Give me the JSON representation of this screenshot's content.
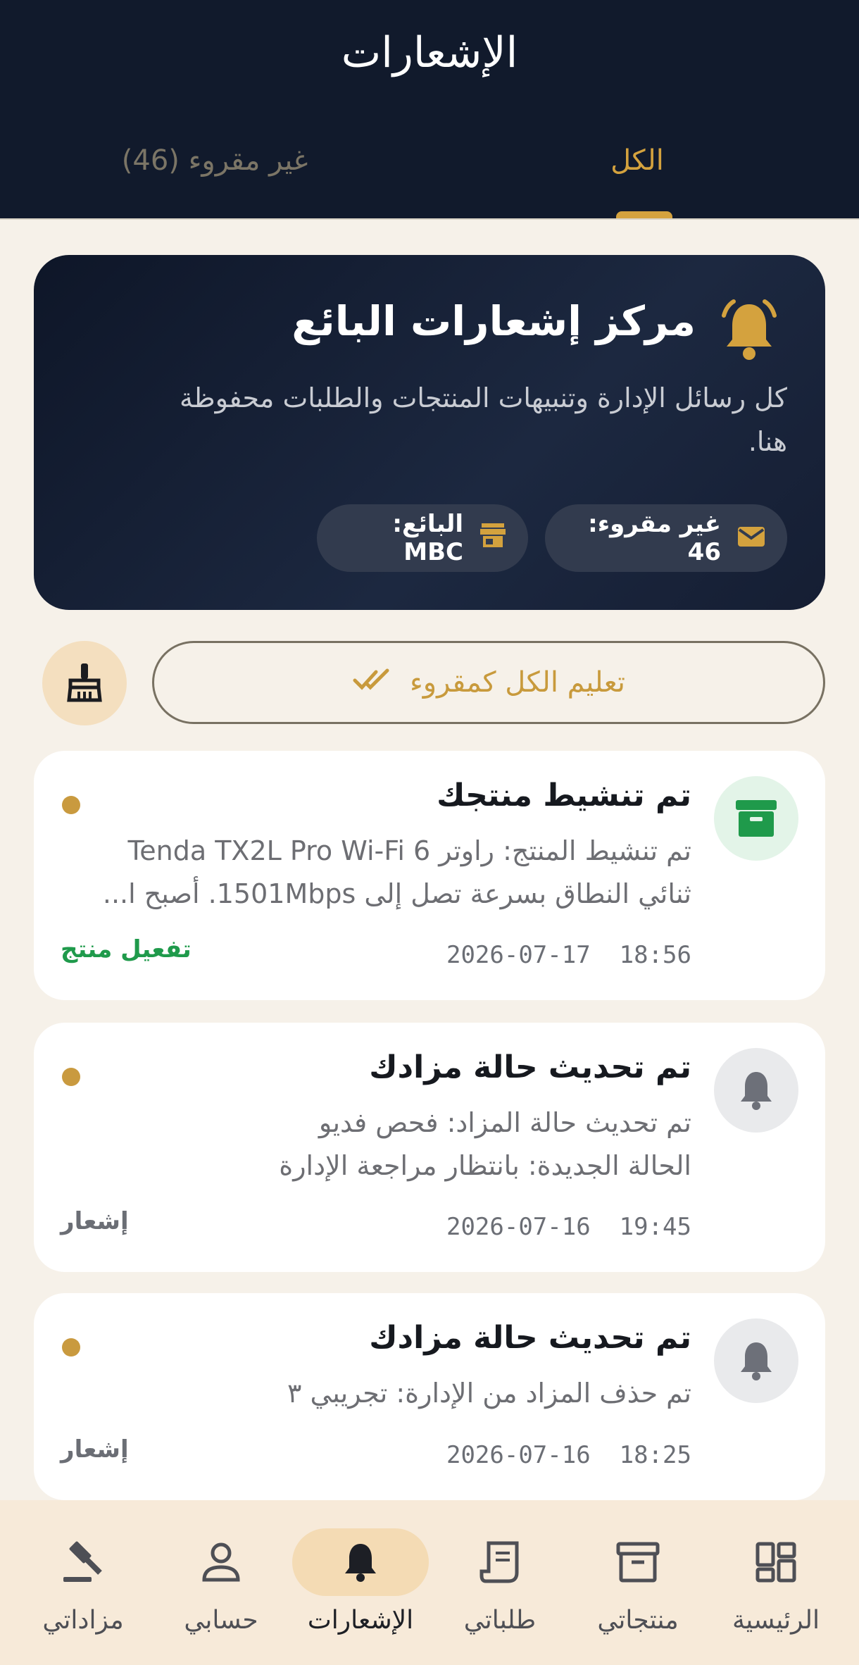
{
  "header": {
    "title": "الإشعارات",
    "tabs": [
      {
        "label": "الكل",
        "active": true
      },
      {
        "label": "غير مقروء (46)",
        "active": false
      }
    ]
  },
  "hero": {
    "title": "مركز إشعارات البائع",
    "description_line1": "كل رسائل الإدارة وتنبيهات المنتجات والطلبات محفوظة",
    "description_line2": "هنا.",
    "unread_chip": "غير مقروء: 46",
    "seller_chip": "البائع: MBC",
    "icons": [
      "bell-icon",
      "mail-icon",
      "store-icon"
    ]
  },
  "actions": {
    "mark_all_read": "تعليم الكل كمقروء",
    "icons": [
      "double-check-icon",
      "brush-icon"
    ]
  },
  "notifications": [
    {
      "title": "تم تنشيط منتجك",
      "body_line1": "تم تنشيط المنتج: راوتر Tenda TX2L Pro Wi-Fi 6",
      "body_line2": "ثنائي النطاق بسرعة تصل إلى 1501Mbps. أصبح ا...",
      "date": "2026-07-17",
      "time": "18:56",
      "tag": "تفعيل منتج",
      "icon": "archive-box-icon",
      "unread": true
    },
    {
      "title": "تم تحديث حالة مزادك",
      "body_line1": "تم تحديث حالة المزاد: فحص فديو",
      "body_line2": "الحالة الجديدة: بانتظار مراجعة الإدارة",
      "date": "2026-07-16",
      "time": "19:45",
      "tag": "إشعار",
      "icon": "bell-icon",
      "unread": true
    },
    {
      "title": "تم تحديث حالة مزادك",
      "body_line1": "تم حذف المزاد من الإدارة: تجريبي ٣",
      "date": "2026-07-16",
      "time": "18:25",
      "tag": "إشعار",
      "icon": "bell-icon",
      "unread": true
    }
  ],
  "bottom_nav": [
    {
      "label": "الرئيسية",
      "icon": "dashboard-icon"
    },
    {
      "label": "منتجاتي",
      "icon": "archive-icon"
    },
    {
      "label": "طلباتي",
      "icon": "receipt-icon"
    },
    {
      "label": "الإشعارات",
      "icon": "bell-icon",
      "active": true
    },
    {
      "label": "حسابي",
      "icon": "person-icon"
    },
    {
      "label": "مزاداتي",
      "icon": "gavel-icon"
    }
  ],
  "colors": {
    "header_bg": "#111a2c",
    "accent_gold": "#d4a23e",
    "page_bg": "#f6f1e9",
    "success_green": "#1f9a4b",
    "nav_active_bg": "#f4dbb4"
  }
}
